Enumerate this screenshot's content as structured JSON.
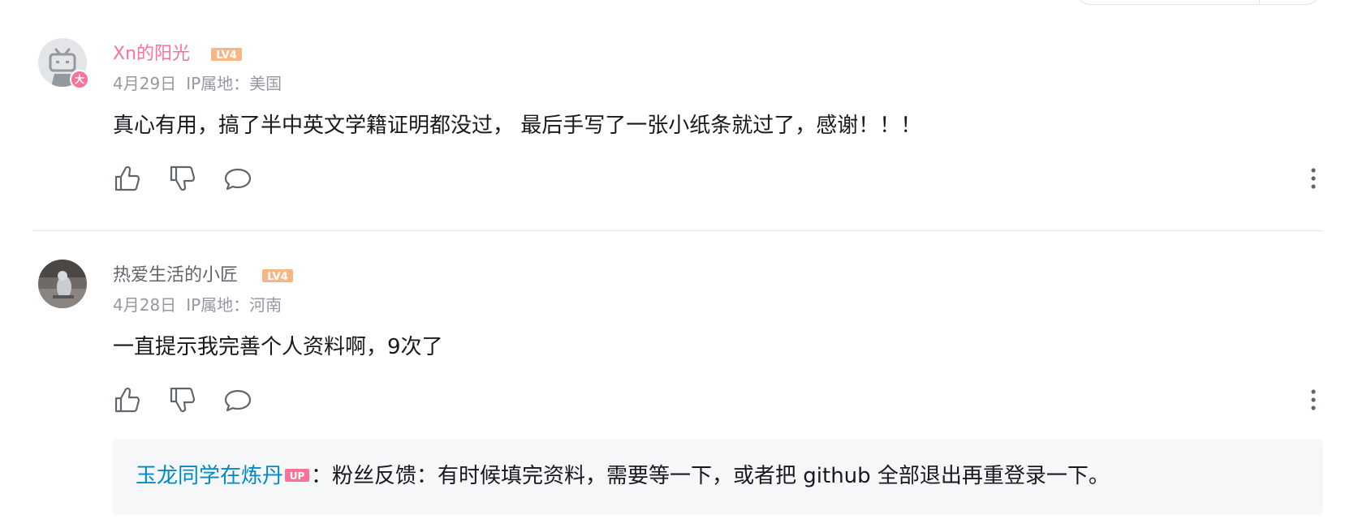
{
  "comments": [
    {
      "username": "Xn的阳光",
      "level": "LV4",
      "vip_badge": "大",
      "date": "4月29日",
      "ip_location": "IP属地：美国",
      "content": "真心有用，搞了半中英文学籍证明都没过， 最后手写了一张小纸条就过了，感谢！！！"
    },
    {
      "username": "热爱生活的小匠",
      "level": "LV4",
      "date": "4月28日",
      "ip_location": "IP属地：河南",
      "content": "一直提示我完善个人资料啊，9次了",
      "reply": {
        "username": "玉龙同学在炼丹",
        "up_tag": "UP",
        "text": "：粉丝反馈：有时候填完资料，需要等一下，或者把 github 全部退出再重登录一下。"
      }
    }
  ],
  "colors": {
    "username_vip": "#fb7299",
    "username_normal": "#61666d",
    "meta": "#9499a0",
    "level_badge": "#f6b784",
    "reply_user": "#008ac5",
    "up_tag": "#fb7299",
    "reply_bg": "#f6f7f8"
  },
  "icons": [
    "like-icon",
    "dislike-icon",
    "reply-icon",
    "more-icon"
  ]
}
